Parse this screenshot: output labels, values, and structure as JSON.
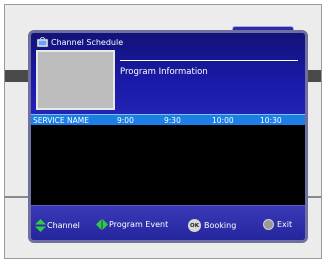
{
  "window": {
    "title": "Channel Schedule"
  },
  "info": {
    "program_information": "Program Information"
  },
  "grid": {
    "headers": [
      "SERVICE NAME",
      "9:00",
      "9:30",
      "10:00",
      "10:30"
    ]
  },
  "legend": {
    "channel_label": "Channel",
    "program_event_label": "Program Event",
    "ok_key": "OK",
    "booking_label": "Booking",
    "exit_label": "Exit"
  },
  "colors": {
    "panel_blue": "#1a1aa8",
    "header_blue": "#1c7fe6",
    "updown_arrow_green": "#2ecc40",
    "arrow_green": "#2ecc40"
  }
}
